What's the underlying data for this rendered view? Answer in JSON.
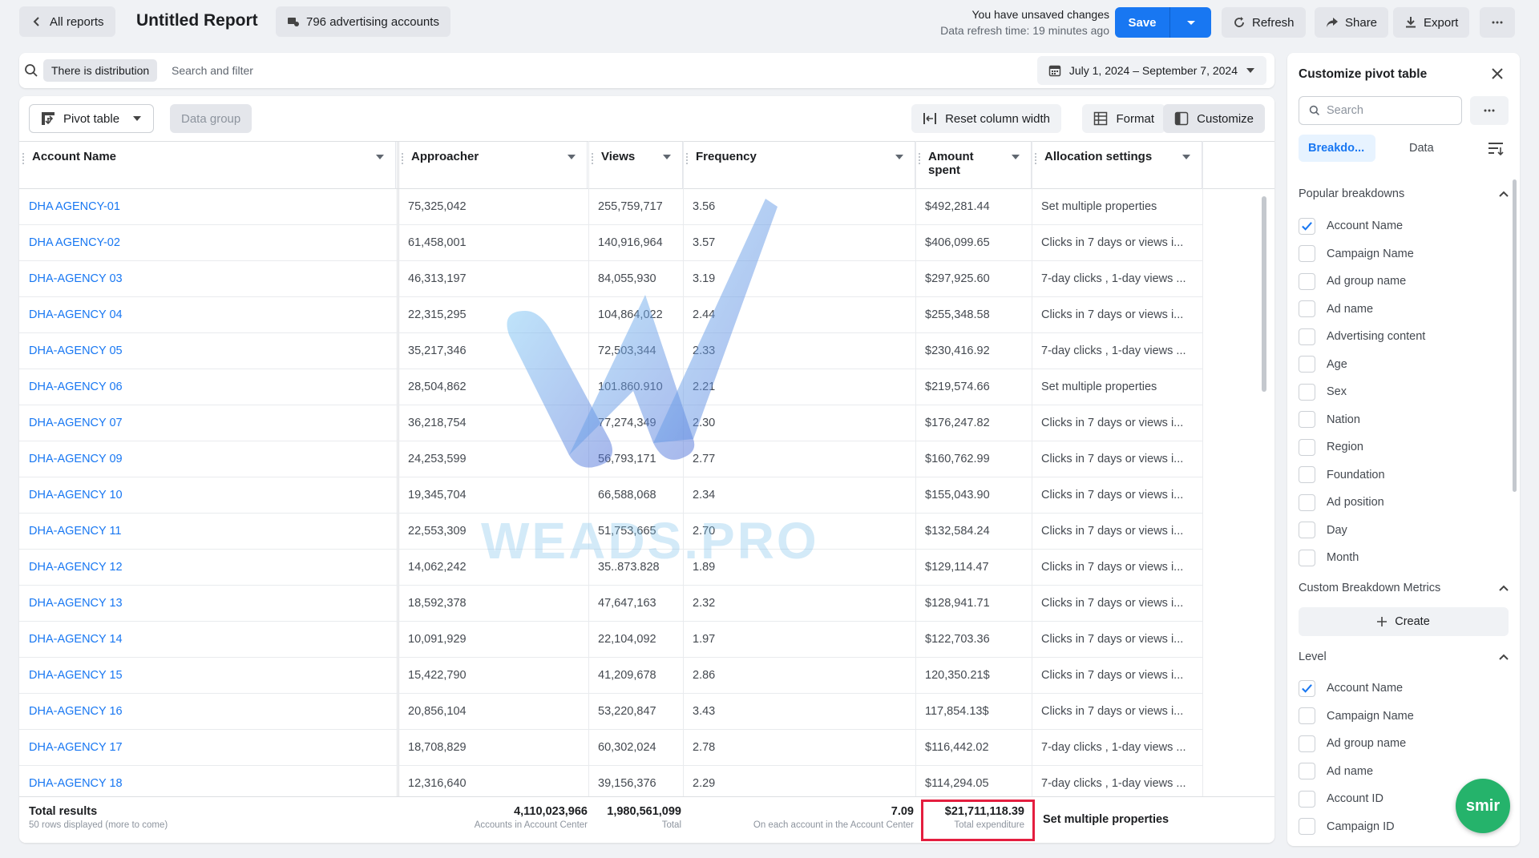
{
  "topbar": {
    "back_label": "All reports",
    "title": "Untitled Report",
    "accounts_label": "796 advertising accounts",
    "unsaved_text": "You have unsaved changes",
    "refresh_time": "Data refresh time: 19 minutes ago",
    "save_label": "Save",
    "refresh_label": "Refresh",
    "share_label": "Share",
    "export_label": "Export"
  },
  "filter": {
    "chip": "There is distribution",
    "placeholder": "Search and filter",
    "date_range": "July 1, 2024 – September 7, 2024"
  },
  "toolbar": {
    "pivot_label": "Pivot table",
    "datagroup_label": "Data group",
    "reset_label": "Reset column width",
    "format_label": "Format",
    "customize_label": "Customize"
  },
  "table": {
    "columns": [
      "Account Name",
      "Approacher",
      "Views",
      "Frequency",
      "Amount spent",
      "Allocation settings"
    ],
    "rows": [
      [
        "DHA AGENCY-01",
        "75,325,042",
        "255,759,717",
        "3.56",
        "$492,281.44",
        "Set multiple properties"
      ],
      [
        "DHA AGENCY-02",
        "61,458,001",
        "140,916,964",
        "3.57",
        "$406,099.65",
        "Clicks in 7 days or views i..."
      ],
      [
        "DHA-AGENCY 03",
        "46,313,197",
        "84,055,930",
        "3.19",
        "$297,925.60",
        "7-day clicks , 1-day views ..."
      ],
      [
        "DHA-AGENCY 04",
        "22,315,295",
        "104,864,022",
        "2.44",
        "$255,348.58",
        "Clicks in 7 days or views i..."
      ],
      [
        "DHA-AGENCY 05",
        "35,217,346",
        "72,503,344",
        "2.33",
        "$230,416.92",
        "7-day clicks , 1-day views ..."
      ],
      [
        "DHA-AGENCY 06",
        "28,504,862",
        "101.860.910",
        "2.21",
        "$219,574.66",
        "Set multiple properties"
      ],
      [
        "DHA-AGENCY 07",
        "36,218,754",
        "77,274,349",
        "2.30",
        "$176,247.82",
        "Clicks in 7 days or views i..."
      ],
      [
        "DHA-AGENCY 09",
        "24,253,599",
        "56,793,171",
        "2.77",
        "$160,762.99",
        "Clicks in 7 days or views i..."
      ],
      [
        "DHA-AGENCY 10",
        "19,345,704",
        "66,588,068",
        "2.34",
        "$155,043.90",
        "Clicks in 7 days or views i..."
      ],
      [
        "DHA-AGENCY 11",
        "22,553,309",
        "51,753,665",
        "2.70",
        "$132,584.24",
        "Clicks in 7 days or views i..."
      ],
      [
        "DHA-AGENCY 12",
        "14,062,242",
        "35..873.828",
        "1.89",
        "$129,114.47",
        "Clicks in 7 days or views i..."
      ],
      [
        "DHA-AGENCY 13",
        "18,592,378",
        "47,647,163",
        "2.32",
        "$128,941.71",
        "Clicks in 7 days or views i..."
      ],
      [
        "DHA-AGENCY 14",
        "10,091,929",
        "22,104,092",
        "1.97",
        "$122,703.36",
        "Clicks in 7 days or views i..."
      ],
      [
        "DHA-AGENCY 15",
        "15,422,790",
        "41,209,678",
        "2.86",
        "120,350.21$",
        "Clicks in 7 days or views i..."
      ],
      [
        "DHA-AGENCY 16",
        "20,856,104",
        "53,220,847",
        "3.43",
        "117,854.13$",
        "Clicks in 7 days or views i..."
      ],
      [
        "DHA-AGENCY 17",
        "18,708,829",
        "60,302,024",
        "2.78",
        "$116,442.02",
        "7-day clicks , 1-day views ..."
      ],
      [
        "DHA-AGENCY 18",
        "12,316,640",
        "39,156,376",
        "2.29",
        "$114,294.05",
        "7-day clicks , 1-day views ..."
      ]
    ],
    "footer": {
      "label": "Total results",
      "sublabel": "50 rows displayed (more to come)",
      "approacher": "4,110,023,966",
      "approacher_note": "Accounts in Account Center",
      "views": "1,980,561,099",
      "views_note": "Total",
      "frequency": "7.09",
      "frequency_note": "On each account in the Account Center",
      "amount": "$21,711,118.39",
      "amount_note": "Total expenditure",
      "allocation": "Set multiple properties"
    }
  },
  "watermark": "WEADS.PRO",
  "panel": {
    "title": "Customize pivot table",
    "search_placeholder": "Search",
    "tab_breakdown": "Breakdo...",
    "tab_data": "Data",
    "popular_title": "Popular breakdowns",
    "popular": [
      {
        "label": "Account Name",
        "checked": true
      },
      {
        "label": "Campaign Name",
        "checked": false
      },
      {
        "label": "Ad group name",
        "checked": false
      },
      {
        "label": "Ad name",
        "checked": false
      },
      {
        "label": "Advertising content",
        "checked": false
      },
      {
        "label": "Age",
        "checked": false
      },
      {
        "label": "Sex",
        "checked": false
      },
      {
        "label": "Nation",
        "checked": false
      },
      {
        "label": "Region",
        "checked": false
      },
      {
        "label": "Foundation",
        "checked": false
      },
      {
        "label": "Ad position",
        "checked": false
      },
      {
        "label": "Day",
        "checked": false
      },
      {
        "label": "Month",
        "checked": false
      }
    ],
    "custom_title": "Custom Breakdown Metrics",
    "create_label": "Create",
    "level_title": "Level",
    "level": [
      {
        "label": "Account Name",
        "checked": true
      },
      {
        "label": "Campaign Name",
        "checked": false
      },
      {
        "label": "Ad group name",
        "checked": false
      },
      {
        "label": "Ad name",
        "checked": false
      },
      {
        "label": "Account ID",
        "checked": false
      },
      {
        "label": "Campaign ID",
        "checked": false
      }
    ]
  },
  "chat_badge": "smir"
}
